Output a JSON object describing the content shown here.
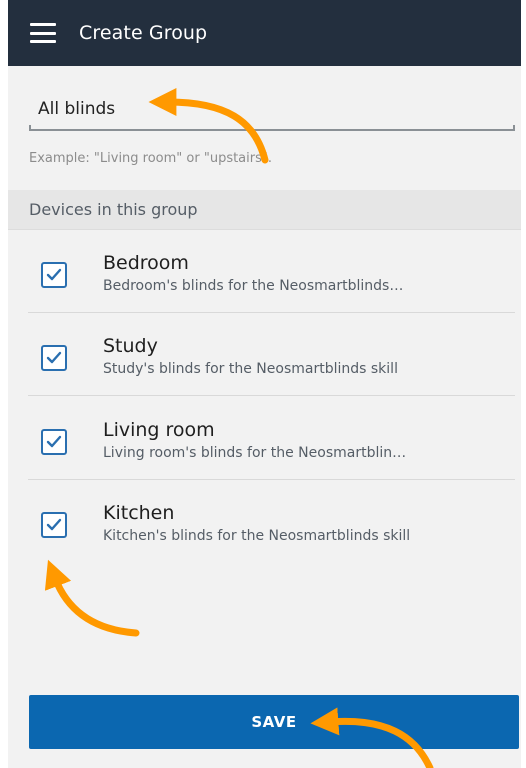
{
  "app_bar": {
    "title": "Create Group",
    "menu_icon": "hamburger-menu-icon"
  },
  "group_name": {
    "value": "All blinds",
    "helper": "Example: \"Living room\" or \"upstairs\"."
  },
  "devices_section": {
    "header": "Devices in this group",
    "items": [
      {
        "name": "Bedroom",
        "description": "Bedroom's blinds for the Neosmartblinds…",
        "checked": true
      },
      {
        "name": "Study",
        "description": "Study's blinds for the Neosmartblinds skill",
        "checked": true
      },
      {
        "name": "Living room",
        "description": "Living room's blinds for the Neosmartblin…",
        "checked": true
      },
      {
        "name": "Kitchen",
        "description": "Kitchen's blinds for the Neosmartblinds skill",
        "checked": true
      }
    ]
  },
  "save": {
    "label": "SAVE"
  },
  "colors": {
    "app_bar": "#232f3e",
    "accent_blue": "#0b67b0",
    "checkbox_blue": "#2a6fb0",
    "annotation_arrow": "#ff9900"
  }
}
